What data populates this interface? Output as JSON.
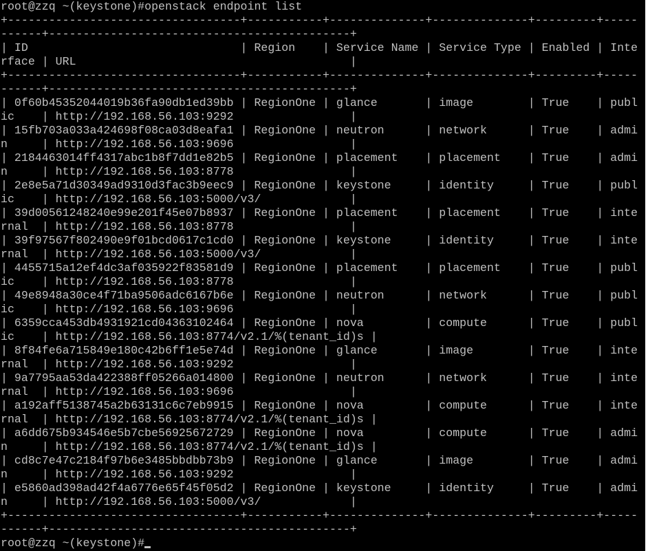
{
  "terminal": {
    "prompt_line": "root@zzq ~(keystone)#openstack endpoint list",
    "final_prompt": "root@zzq ~(keystone)#",
    "lines": [
      "+----------------------------------+-----------+--------------+--------------+---------+-----",
      "------+--------------------------------------------+",
      "| ID                               | Region    | Service Name | Service Type | Enabled | Inte",
      "rface | URL                                        |",
      "+----------------------------------+-----------+--------------+--------------+---------+-----",
      "------+--------------------------------------------+",
      "| 0f60b45352044019b36fa90db1ed39bb | RegionOne | glance       | image        | True    | publ",
      "ic    | http://192.168.56.103:9292                 |",
      "| 15fb703a033a424698f08ca03d8eafa1 | RegionOne | neutron      | network      | True    | admi",
      "n     | http://192.168.56.103:9696                 |",
      "| 2184463014ff4317abc1b8f7dd1e82b5 | RegionOne | placement    | placement    | True    | admi",
      "n     | http://192.168.56.103:8778                 |",
      "| 2e8e5a71d30349ad9310d3fac3b9eec9 | RegionOne | keystone     | identity     | True    | publ",
      "ic    | http://192.168.56.103:5000/v3/             |",
      "| 39d00561248240e99e201f45e07b8937 | RegionOne | placement    | placement    | True    | inte",
      "rnal  | http://192.168.56.103:8778                 |",
      "| 39f97567f802490e9f01bcd0617c1cd0 | RegionOne | keystone     | identity     | True    | inte",
      "rnal  | http://192.168.56.103:5000/v3/             |",
      "| 4455715a12ef4dc3af035922f83581d9 | RegionOne | placement    | placement    | True    | publ",
      "ic    | http://192.168.56.103:8778                 |",
      "| 49e8948a30ce4f71ba9506adc6167b6e | RegionOne | neutron      | network      | True    | publ",
      "ic    | http://192.168.56.103:9696                 |",
      "| 6359cca453db4931921cd04363102464 | RegionOne | nova         | compute      | True    | publ",
      "ic    | http://192.168.56.103:8774/v2.1/%(tenant_id)s |",
      "| 8f84fe6a715849e180c42b6ff1e5e74d | RegionOne | glance       | image        | True    | inte",
      "rnal  | http://192.168.56.103:9292                 |",
      "| 9a7795aa53da422388ff05266a014800 | RegionOne | neutron      | network      | True    | inte",
      "rnal  | http://192.168.56.103:9696                 |",
      "| a192aff5138745a2b63131c6c7eb9915 | RegionOne | nova         | compute      | True    | inte",
      "rnal  | http://192.168.56.103:8774/v2.1/%(tenant_id)s |",
      "| a6dd675b934546e5b7cbe56925672729 | RegionOne | nova         | compute      | True    | admi",
      "n     | http://192.168.56.103:8774/v2.1/%(tenant_id)s |",
      "| cd8c7e47c2184f97b6e3485bbdbb73b9 | RegionOne | glance       | image        | True    | admi",
      "n     | http://192.168.56.103:9292                 |",
      "| e5860ad398ad42f4a6776e65f45f05d2 | RegionOne | keystone     | identity     | True    | admi",
      "n     | http://192.168.56.103:5000/v3/             |",
      "+----------------------------------+-----------+--------------+--------------+---------+-----",
      "------+--------------------------------------------+"
    ]
  },
  "colors": {
    "background": "#000000",
    "foreground": "#c0c0c0",
    "scrollbar": "#ffffff"
  }
}
